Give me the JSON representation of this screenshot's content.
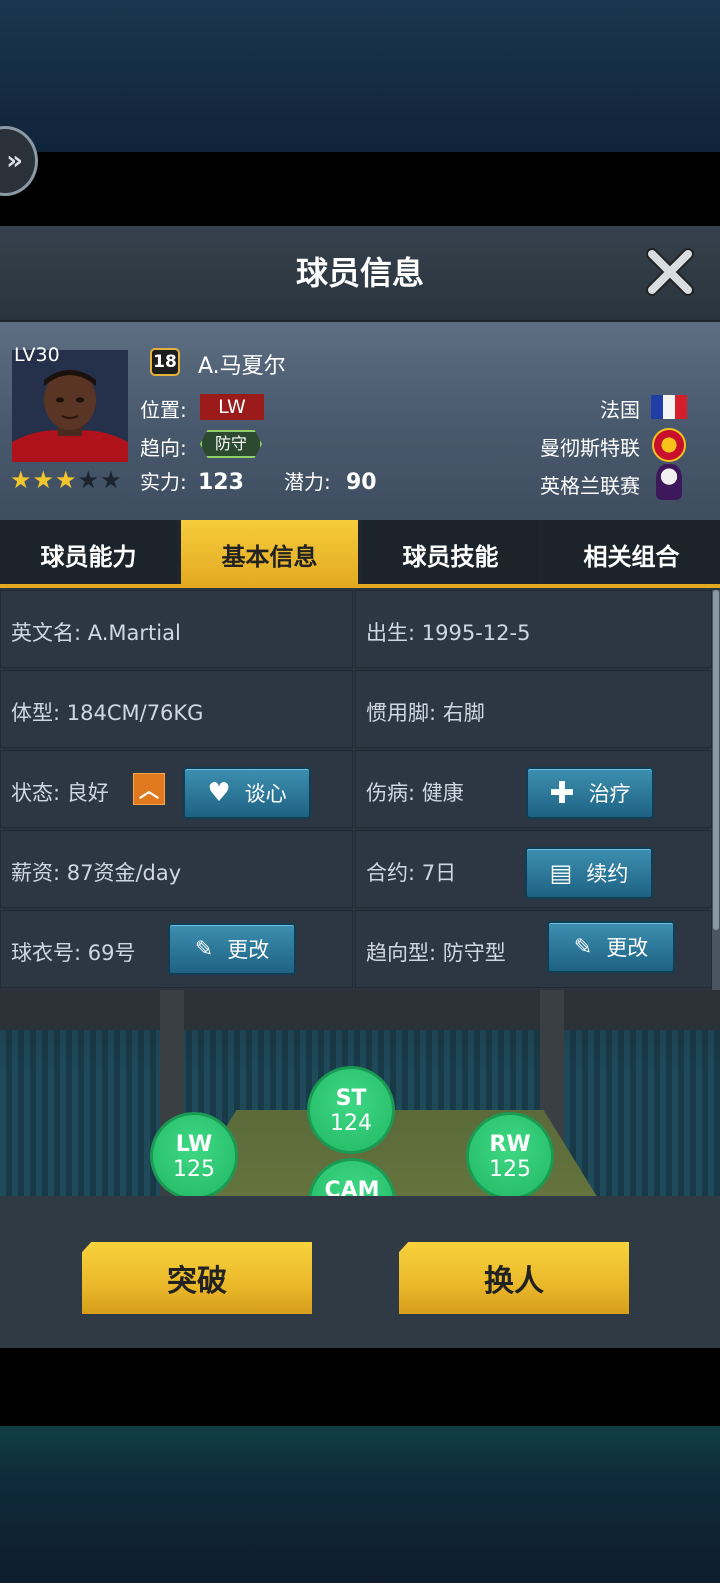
{
  "side_button": {
    "glyph": "»"
  },
  "dialog": {
    "title": "球员信息"
  },
  "player": {
    "level": "LV30",
    "stars": {
      "filled": 3,
      "total": 5
    },
    "number": "18",
    "name": "A.马夏尔",
    "position_label": "位置:",
    "position": "LW",
    "trend_label": "趋向:",
    "trend": "防守",
    "strength_label": "实力:",
    "strength": "123",
    "potential_label": "潜力:",
    "potential": "90",
    "nation": "法国",
    "club": "曼彻斯特联",
    "league": "英格兰联赛"
  },
  "tabs": [
    "球员能力",
    "基本信息",
    "球员技能",
    "相关组合"
  ],
  "active_tab": 1,
  "info": {
    "english_name": "英文名: A.Martial",
    "birth": "出生: 1995-12-5",
    "body": "体型: 184CM/76KG",
    "foot": "惯用脚: 右脚",
    "status": "状态: 良好",
    "status_trend": "up",
    "talk_btn": "谈心",
    "injury": "伤病: 健康",
    "treat_btn": "治疗",
    "salary": "薪资: 87资金/day",
    "contract": "合约: 7日",
    "renew_btn": "续约",
    "jersey": "球衣号: 69号",
    "change_btn_1": "更改",
    "trend_type": "趋向型: 防守型",
    "change_btn_2": "更改"
  },
  "formation": [
    {
      "pos": "ST",
      "val": "124"
    },
    {
      "pos": "LW",
      "val": "125"
    },
    {
      "pos": "RW",
      "val": "125"
    },
    {
      "pos": "CAM",
      "val": ""
    }
  ],
  "actions": {
    "breakthrough": "突破",
    "swap": "换人"
  },
  "colors": {
    "accent": "#e2a921",
    "blue_button": "#2a7a9c",
    "position_red": "#9b1a1a",
    "green_circle": "#2fcb74"
  }
}
